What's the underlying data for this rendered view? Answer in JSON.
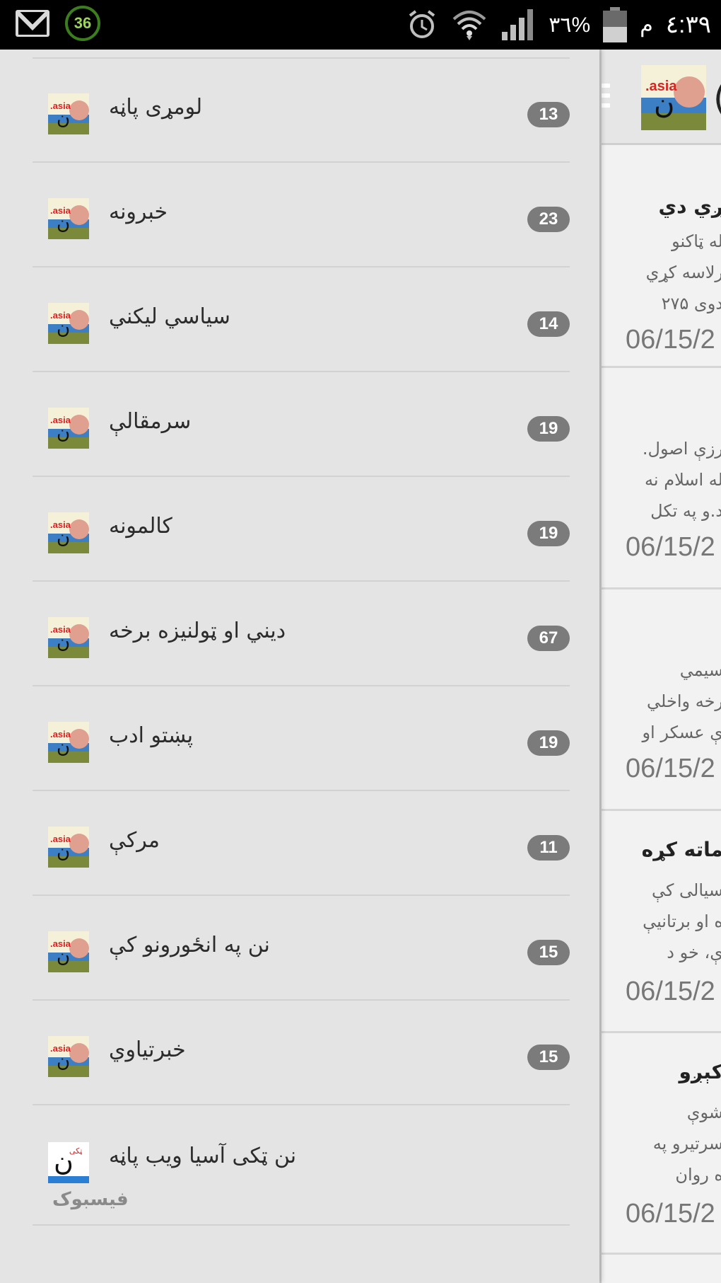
{
  "status_bar": {
    "notification_count": "36",
    "battery": "٣٦%",
    "time": "٤:٣٩",
    "ampm": "م",
    "icons": [
      "mail-icon",
      "alarm-icon",
      "wifi-icon",
      "signal-icon",
      "battery-icon"
    ]
  },
  "drawer": {
    "items": [
      {
        "label": "لومړی پاڼه",
        "count": "13"
      },
      {
        "label": "خبرونه",
        "count": "23"
      },
      {
        "label": "سیاسي لیکني",
        "count": "14"
      },
      {
        "label": "سرمقالې",
        "count": "19"
      },
      {
        "label": "کالمونه",
        "count": "19"
      },
      {
        "label": "ديني او ټولنيزه برخه",
        "count": "67"
      },
      {
        "label": "پښتو ادب",
        "count": "19"
      },
      {
        "label": "مرکې",
        "count": "11"
      },
      {
        "label": "نن په انځورونو کې",
        "count": "15"
      },
      {
        "label": "خبرتیاوي",
        "count": "15"
      }
    ],
    "website_item": {
      "label": "نن ټکی آسیا ویب پاڼه"
    },
    "section_label": "فیسبوک"
  },
  "background": {
    "cards": [
      {
        "title": "ږي دي",
        "lines": [
          "له ټاکنو",
          "رلاسه کړي",
          "دوی ۲۷۵"
        ],
        "date": "06/15/2"
      },
      {
        "title": "",
        "lines": [
          "رزې اصول.",
          "له اسلام نه",
          "د.و په تکل"
        ],
        "date": "06/15/2"
      },
      {
        "title": "",
        "lines": [
          "سیمي",
          "رخه واخلي",
          "ې عسکر او"
        ],
        "date": "06/15/2"
      },
      {
        "title": "ماته کړه",
        "lines": [
          "سیالی کې",
          "ه او برتانيې",
          "ې، خو د"
        ],
        "date": "06/15/2"
      },
      {
        "title": "کېږو",
        "lines": [
          "شوې",
          "سرتيرو په",
          "ه روان"
        ],
        "date": "06/15/2"
      }
    ]
  },
  "colors": {
    "drawer_bg": "#e4e4e4",
    "count_badge": "#7b7b7b",
    "status_bar": "#000000"
  }
}
